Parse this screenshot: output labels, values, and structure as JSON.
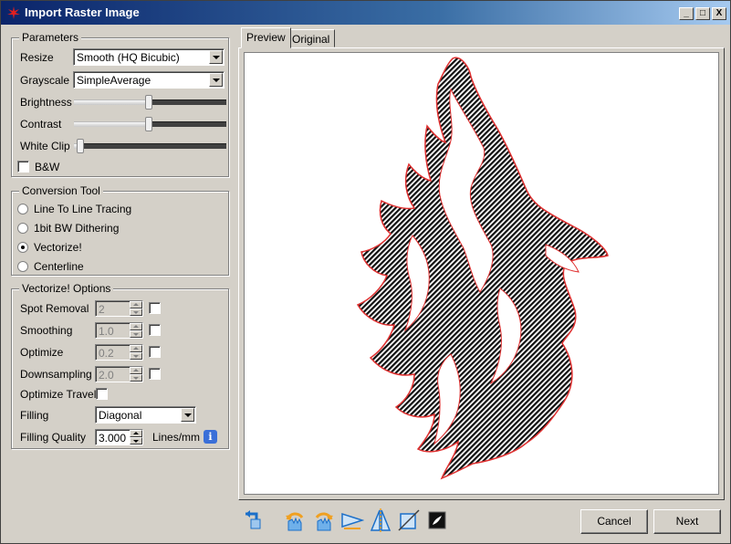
{
  "window": {
    "title": "Import Raster Image",
    "controls": {
      "minimize": "_",
      "maximize": "□",
      "close": "X"
    }
  },
  "parameters": {
    "legend": "Parameters",
    "resize_label": "Resize",
    "resize_value": "Smooth (HQ Bicubic)",
    "grayscale_label": "Grayscale",
    "grayscale_value": "SimpleAverage",
    "brightness_label": "Brightness",
    "brightness_level": 0.49,
    "contrast_label": "Contrast",
    "contrast_level": 0.49,
    "whiteclip_label": "White Clip",
    "whiteclip_level": 0.02,
    "bw_label": "B&W",
    "bw_checked": false
  },
  "conversion_tool": {
    "legend": "Conversion Tool",
    "options": [
      {
        "label": "Line To Line Tracing",
        "selected": false
      },
      {
        "label": "1bit BW Dithering",
        "selected": false
      },
      {
        "label": "Vectorize!",
        "selected": true
      },
      {
        "label": "Centerline",
        "selected": false
      }
    ]
  },
  "vectorize_options": {
    "legend": "Vectorize! Options",
    "spot_removal_label": "Spot Removal",
    "spot_removal_value": "2",
    "smoothing_label": "Smoothing",
    "smoothing_value": "1.0",
    "optimize_label": "Optimize",
    "optimize_value": "0.2",
    "downsampling_label": "Downsampling",
    "downsampling_value": "2.0",
    "optimize_travel_label": "Optimize Travel",
    "filling_label": "Filling",
    "filling_value": "Diagonal",
    "filling_quality_label": "Filling Quality",
    "filling_quality_value": "3.000",
    "filling_quality_unit": "Lines/mm",
    "info_glyph": "i"
  },
  "tabs": [
    {
      "label": "Preview",
      "active": true
    },
    {
      "label": "Original",
      "active": false
    }
  ],
  "preview": {
    "image": "howling-wolf-tribal-hatched"
  },
  "toolbar": {
    "icons": [
      "reset-icon",
      "rotate-ccw-icon",
      "rotate-cw-icon",
      "flip-horizontal-icon",
      "flip-vertical-icon",
      "crop-icon",
      "invert-icon"
    ]
  },
  "buttons": {
    "cancel": "Cancel",
    "next": "Next"
  },
  "colors": {
    "titlebar": "#0a246a",
    "dialog": "#d4d0c8",
    "outline": "#e03030",
    "info": "#3a6fd8"
  }
}
